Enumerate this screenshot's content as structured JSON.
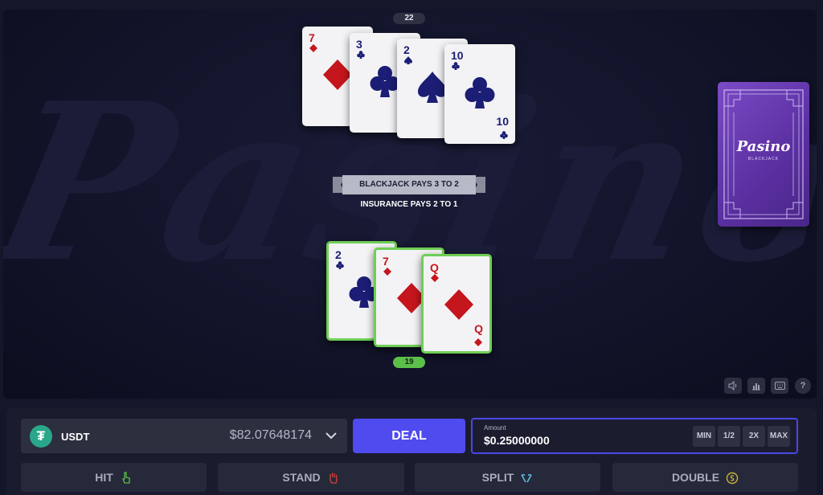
{
  "table": {
    "watermark": "Pasino",
    "dealer": {
      "score": "22",
      "cards": [
        {
          "rank": "7",
          "suit": "diamond",
          "color": "red"
        },
        {
          "rank": "3",
          "suit": "club",
          "color": "blue"
        },
        {
          "rank": "2",
          "suit": "spade",
          "color": "blue"
        },
        {
          "rank": "10",
          "suit": "club",
          "color": "blue"
        }
      ]
    },
    "player": {
      "score": "19",
      "cards": [
        {
          "rank": "2",
          "suit": "club",
          "color": "blue"
        },
        {
          "rank": "7",
          "suit": "diamond",
          "color": "red"
        },
        {
          "rank": "Q",
          "suit": "diamond",
          "color": "red"
        }
      ]
    },
    "rules": {
      "blackjack": "BLACKJACK PAYS 3 TO 2",
      "insurance": "INSURANCE PAYS 2 TO 1"
    },
    "deck": {
      "logo": "Pasino",
      "subtitle": "BLACKJACK"
    },
    "tools": {
      "help": "?"
    }
  },
  "wallet": {
    "currency": "USDT",
    "icon": "tether-icon",
    "balance": "$82.07648174"
  },
  "deal_label": "DEAL",
  "amount": {
    "label": "Amount",
    "value": "$0.25000000",
    "min": "MIN",
    "half": "1/2",
    "double": "2X",
    "max": "MAX"
  },
  "actions": {
    "hit": "HIT",
    "stand": "STAND",
    "split": "SPLIT",
    "double": "DOUBLE"
  },
  "colors": {
    "accent": "#4f4bef",
    "win_green": "#6fce55",
    "card_red": "#c4161c",
    "card_blue": "#1b1e74"
  }
}
